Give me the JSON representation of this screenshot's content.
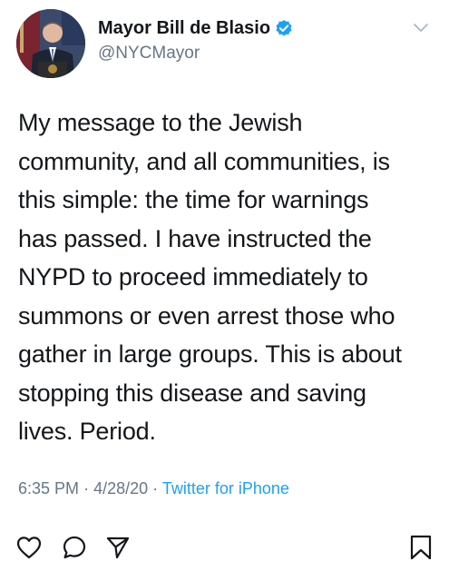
{
  "author": {
    "display_name": "Mayor Bill de Blasio",
    "handle": "@NYCMayor",
    "verified": true,
    "verified_color": "#1da1f2"
  },
  "tweet": {
    "text_lines": [
      "My message to the Jewish",
      "community, and all communities, is",
      "this simple: the time for warnings",
      "has passed. I have instructed the",
      "NYPD to proceed immediately to",
      "summons or even arrest those who",
      "gather in large groups. This is about",
      "stopping this disease and saving",
      "lives. Period."
    ],
    "time": "6:35 PM",
    "separator": "·",
    "date": "4/28/20",
    "source": "Twitter for iPhone"
  },
  "icons": {
    "menu": "chevron-down-icon",
    "like": "heart-icon",
    "reply": "comment-icon",
    "share": "send-icon",
    "bookmark": "bookmark-icon",
    "verified": "verified-badge-icon"
  },
  "colors": {
    "text": "#14171a",
    "secondary": "#657786",
    "link": "#1da1f2"
  }
}
